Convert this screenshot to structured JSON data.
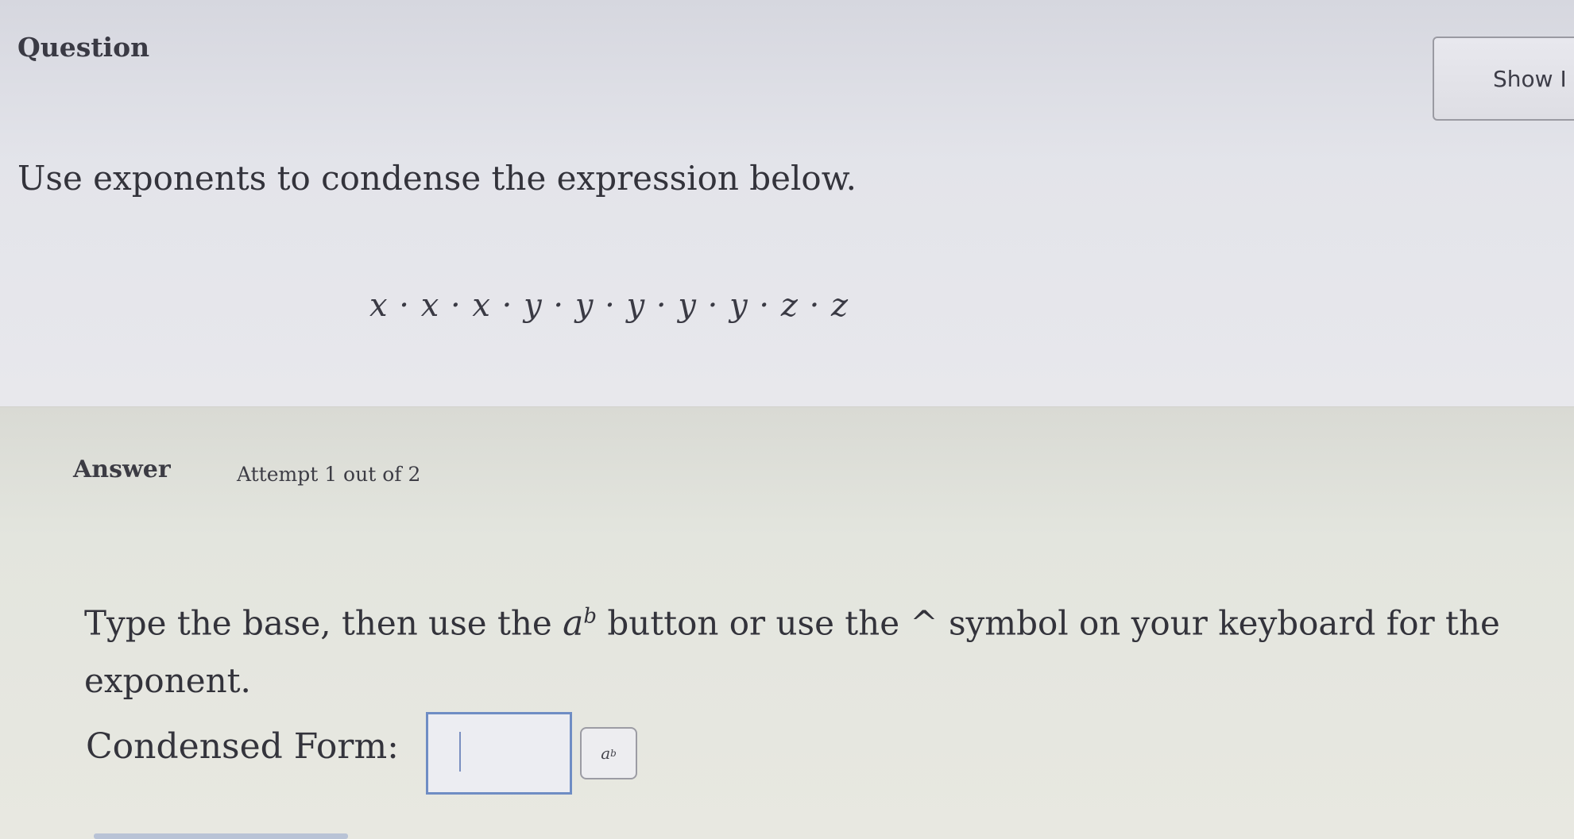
{
  "question": {
    "label": "Question",
    "show_button_label": "Show I",
    "prompt": "Use exponents to condense the expression below.",
    "expression": "x · x · x · y · y · y · y · y · z · z"
  },
  "answer": {
    "label": "Answer",
    "attempt_text": "Attempt 1 out of 2",
    "instruction_before": "Type the base, then use the ",
    "instruction_base": "a",
    "instruction_exponent": "b",
    "instruction_after": " button or use the ^ symbol on your keyboard for the exponent.",
    "condensed_label": "Condensed Form:",
    "input_value": "",
    "exponent_button_base": "a",
    "exponent_button_exp": "b"
  }
}
